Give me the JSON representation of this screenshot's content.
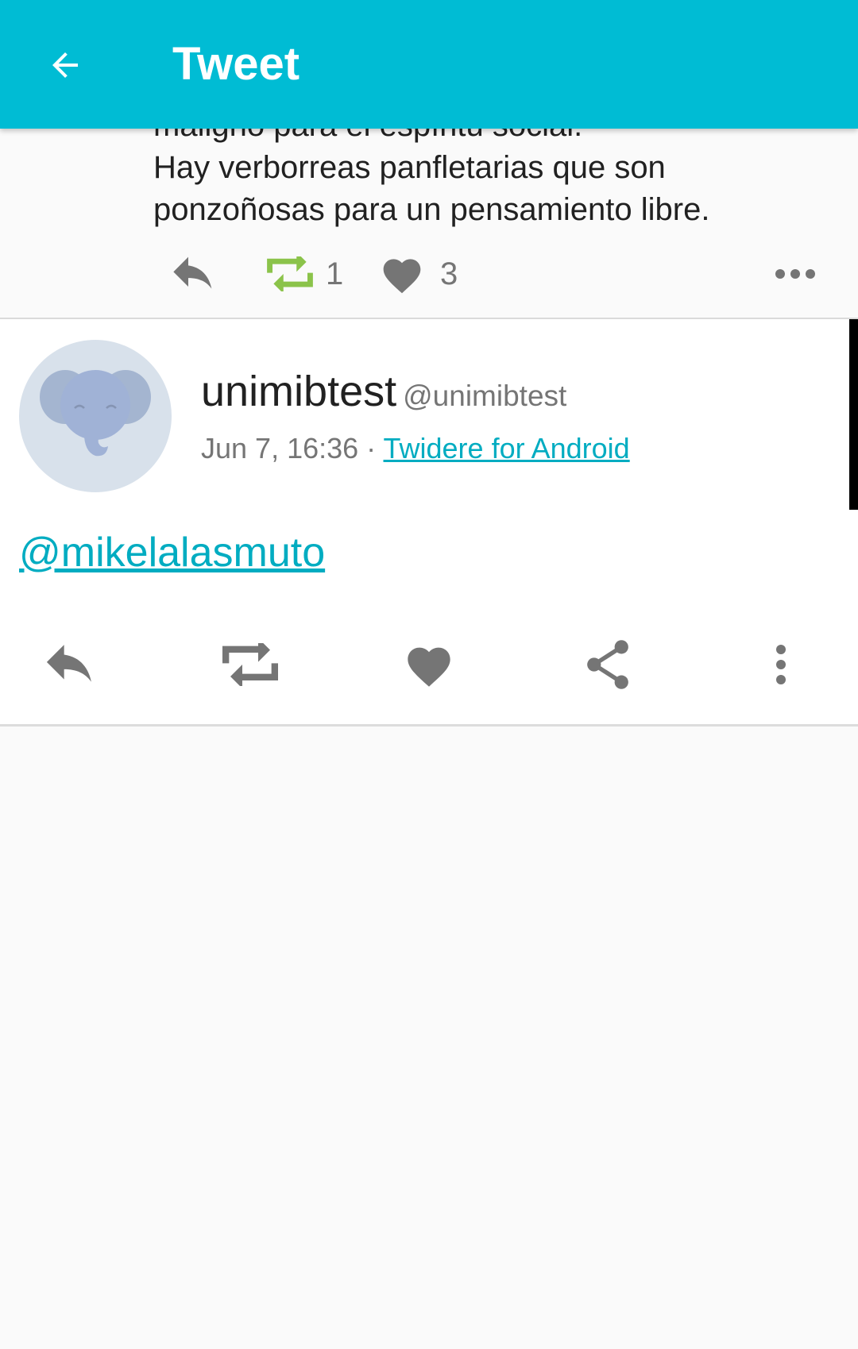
{
  "appbar": {
    "title": "Tweet",
    "color": "#00bcd4"
  },
  "previous_tweet": {
    "text_lines": [
      "maligno para el espíritu social.",
      "Hay verborreas panfletarias que son",
      "ponzoñosas para un pensamiento libre."
    ],
    "retweet_count": "1",
    "like_count": "3",
    "retweet_color": "#8bc34a"
  },
  "tweet": {
    "display_name": "unimibtest",
    "screen_name": "@unimibtest",
    "time": "Jun 7, 16:36",
    "separator": " · ",
    "source": "Twidere for Android",
    "text": "@mikelalasmuto"
  },
  "icons": {
    "back": "arrow-left-icon",
    "reply": "reply-icon",
    "retweet": "retweet-icon",
    "like": "heart-icon",
    "share": "share-icon",
    "more": "more-vert-icon",
    "more_horiz": "more-horiz-icon",
    "avatar": "elephant-avatar-icon"
  },
  "colors": {
    "link": "#00acc1",
    "icon_gray": "#757575",
    "avatar_bg": "#d8e1eb"
  }
}
